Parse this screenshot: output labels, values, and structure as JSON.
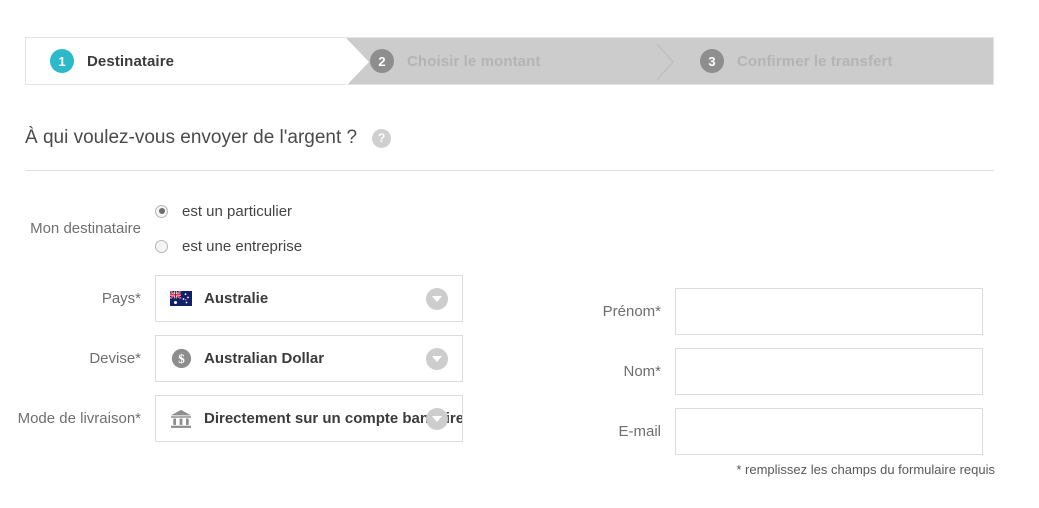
{
  "stepper": {
    "steps": [
      {
        "number": "1",
        "label": "Destinataire",
        "state": "active"
      },
      {
        "number": "2",
        "label": "Choisir le montant",
        "state": "idle"
      },
      {
        "number": "3",
        "label": "Confirmer le transfert",
        "state": "idle"
      }
    ],
    "active_color": "#2cb9c9",
    "idle_badge_color": "#8e8e8e",
    "bar_color": "#cccccc"
  },
  "heading": {
    "title": "À qui voulez-vous envoyer de l'argent ?",
    "help_icon": "help-question-icon",
    "help_glyph": "?"
  },
  "form": {
    "recipient_type": {
      "label": "Mon destinataire",
      "options": [
        {
          "label": "est un particulier",
          "selected": true
        },
        {
          "label": "est une entreprise",
          "selected": false
        }
      ]
    },
    "country": {
      "label": "Pays*",
      "value": "Australie",
      "icon": "australia-flag-icon"
    },
    "currency": {
      "label": "Devise*",
      "value": "Australian Dollar",
      "icon": "dollar-coin-icon"
    },
    "delivery": {
      "label": "Mode de livraison*",
      "value": "Directement sur un compte bancaire",
      "icon": "bank-building-icon"
    },
    "first_name": {
      "label": "Prénom*",
      "value": "",
      "placeholder": ""
    },
    "last_name": {
      "label": "Nom*",
      "value": "",
      "placeholder": ""
    },
    "email": {
      "label": "E-mail",
      "value": "",
      "placeholder": ""
    },
    "required_note": "* remplissez les champs du formulaire requis"
  }
}
